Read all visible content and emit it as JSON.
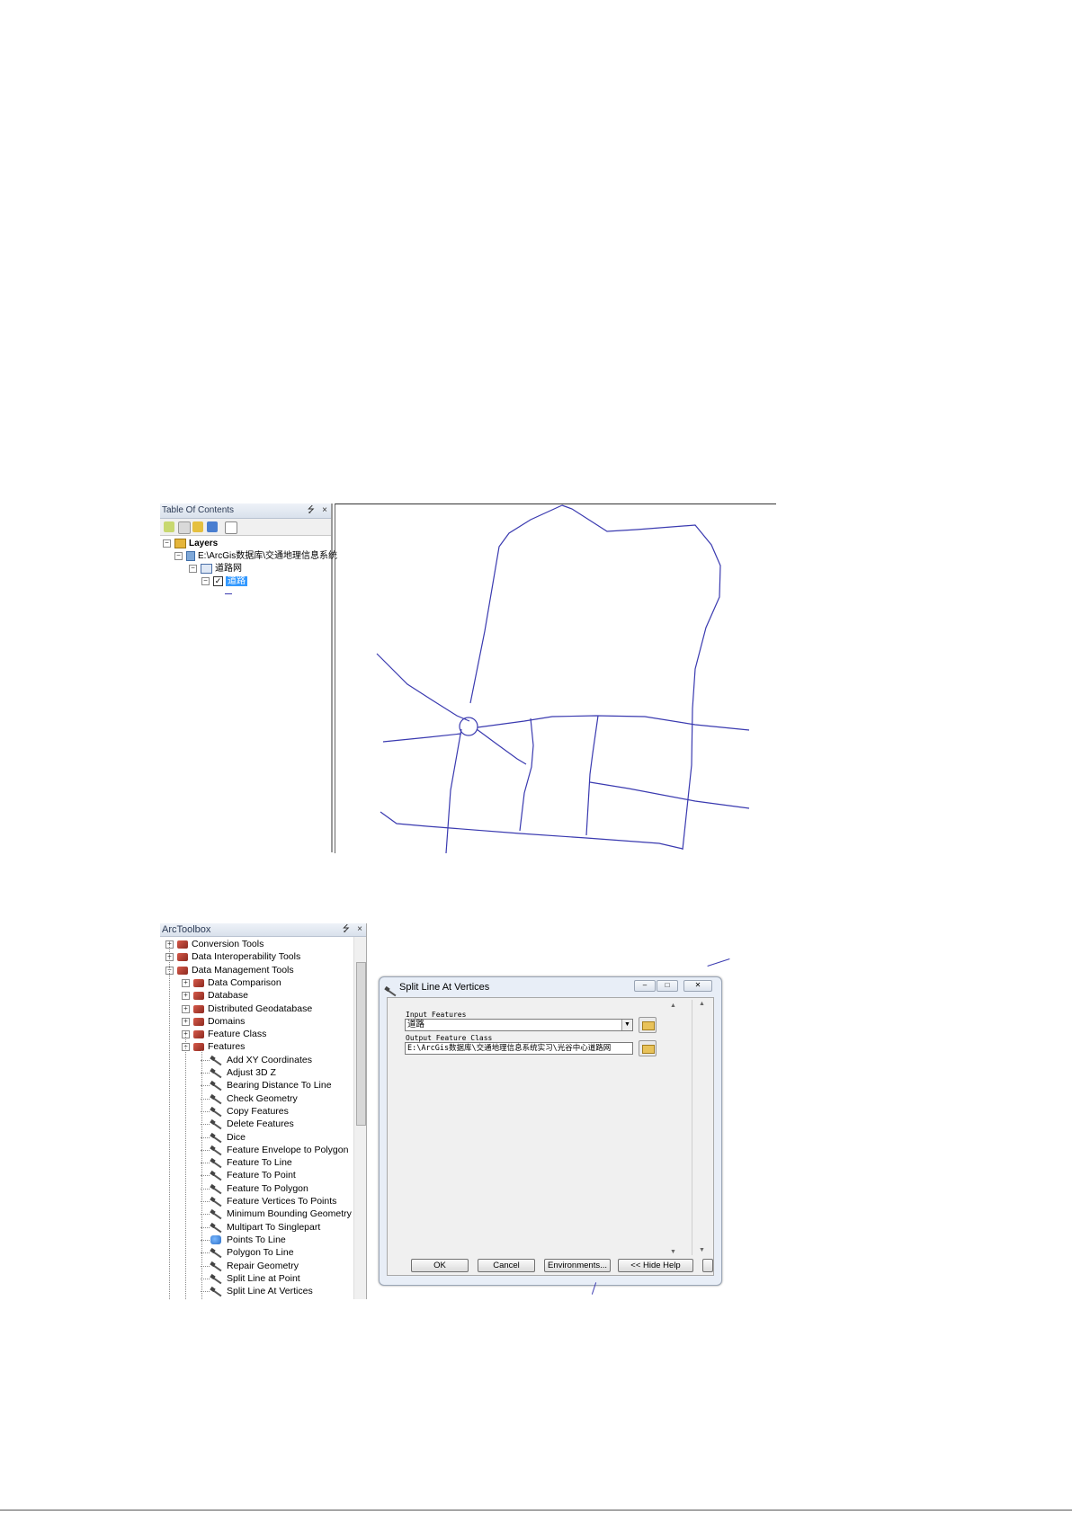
{
  "toc": {
    "title": "Table Of Contents",
    "pin": "⭍",
    "close": "×",
    "tree": {
      "layers": "Layers",
      "gdb": "E:\\ArcGis数据库\\交通地理信息系统",
      "dataset": "道路网",
      "layer": "道路"
    }
  },
  "arctoolbox": {
    "title": "ArcToolbox",
    "pin": "⭍",
    "close": "×",
    "toolsets": [
      {
        "label": "Conversion Tools",
        "level": 0,
        "expand": "+"
      },
      {
        "label": "Data Interoperability Tools",
        "level": 0,
        "expand": "+"
      },
      {
        "label": "Data Management Tools",
        "level": 0,
        "expand": "−"
      },
      {
        "label": "Data Comparison",
        "level": 1,
        "expand": "+"
      },
      {
        "label": "Database",
        "level": 1,
        "expand": "+"
      },
      {
        "label": "Distributed Geodatabase",
        "level": 1,
        "expand": "+"
      },
      {
        "label": "Domains",
        "level": 1,
        "expand": "+"
      },
      {
        "label": "Feature Class",
        "level": 1,
        "expand": "+"
      },
      {
        "label": "Features",
        "level": 1,
        "expand": "−"
      }
    ],
    "tools": [
      "Add XY Coordinates",
      "Adjust 3D Z",
      "Bearing Distance To Line",
      "Check Geometry",
      "Copy Features",
      "Delete Features",
      "Dice",
      "Feature Envelope to Polygon",
      "Feature To Line",
      "Feature To Point",
      "Feature To Polygon",
      "Feature Vertices To Points",
      "Minimum Bounding Geometry",
      "Multipart To Singlepart",
      "Points To Line",
      "Polygon To Line",
      "Repair Geometry",
      "Split Line at Point",
      "Split Line At Vertices"
    ]
  },
  "dialog": {
    "title": "Split Line At Vertices",
    "input_label": "Input Features",
    "input_value": "道路",
    "output_label": "Output Feature Class",
    "output_value": "E:\\ArcGis数据库\\交通地理信息系统实习\\光谷中心道路网",
    "buttons": {
      "ok": "OK",
      "cancel": "Cancel",
      "environments": "Environments...",
      "hide_help": "<< Hide Help"
    },
    "win": {
      "min": "–",
      "max": "□",
      "close": "✕"
    }
  },
  "colors": {
    "road": "#3a3ab0",
    "selection": "#3399ff"
  }
}
